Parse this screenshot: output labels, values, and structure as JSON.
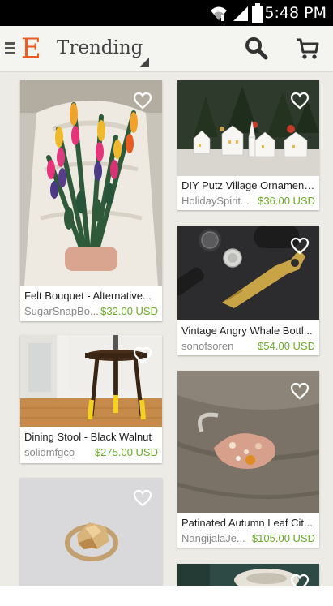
{
  "status_bar": {
    "time": "5:48 PM",
    "icons": [
      "wifi-icon",
      "signal-icon",
      "battery-icon"
    ]
  },
  "action_bar": {
    "logo": "E",
    "title": "Trending",
    "icons": [
      "menu-icon",
      "search-icon",
      "cart-icon"
    ]
  },
  "listings": [
    {
      "name": "Felt Bouquet  - Alternative...",
      "shop": "SugarSnapBo...",
      "price": "$32.00 USD"
    },
    {
      "name": "DIY Putz Village Ornament...",
      "shop": "HolidaySpirit...",
      "price": "$36.00 USD"
    },
    {
      "name": "Vintage Angry Whale Bottl...",
      "shop": "sonofsoren",
      "price": "$54.00 USD"
    },
    {
      "name": "Dining Stool - Black Walnut",
      "shop": "solidmfgco",
      "price": "$275.00 USD"
    },
    {
      "name": "Patinated Autumn Leaf Cit...",
      "shop": "NangijalaJe...",
      "price": "$105.00 USD"
    },
    {
      "name": "",
      "shop": "",
      "price": ""
    },
    {
      "name": "",
      "shop": "",
      "price": ""
    }
  ],
  "colors": {
    "brand": "#e85d22",
    "price": "#6aaa2a",
    "feed_background": "#ecebe5"
  }
}
